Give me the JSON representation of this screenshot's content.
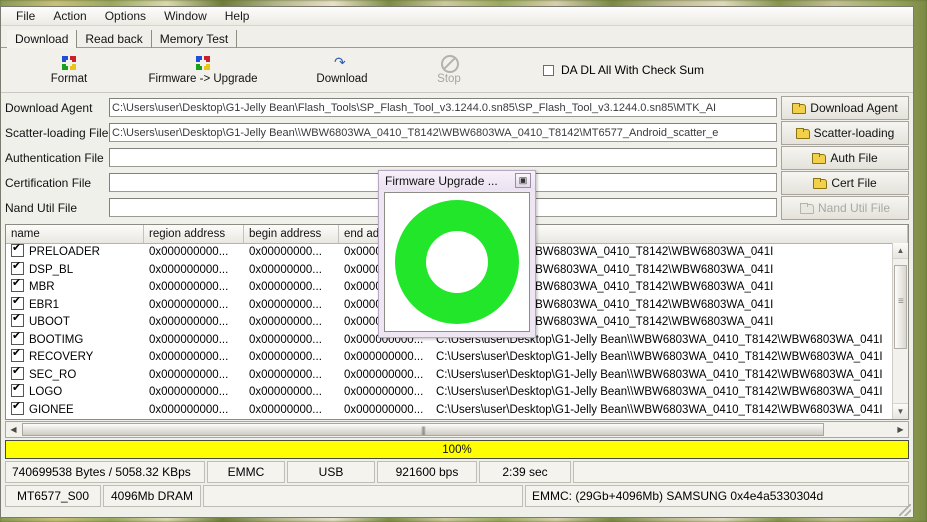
{
  "menu": {
    "items": [
      "File",
      "Action",
      "Options",
      "Window",
      "Help"
    ]
  },
  "tabs": [
    {
      "label": "Download",
      "active": true
    },
    {
      "label": "Read back",
      "active": false
    },
    {
      "label": "Memory Test",
      "active": false
    }
  ],
  "toolbar": {
    "buttons": [
      {
        "label": "Format",
        "icon": "pinwheel-icon",
        "disabled": false
      },
      {
        "label": "Firmware -> Upgrade",
        "icon": "pinwheel-icon",
        "disabled": false
      },
      {
        "label": "Download",
        "icon": "download-arrow-icon",
        "disabled": false
      },
      {
        "label": "Stop",
        "icon": "stop-icon",
        "disabled": true
      }
    ],
    "checkbox": {
      "label": "DA DL All With Check Sum",
      "checked": false
    }
  },
  "file_fields": [
    {
      "label": "Download Agent",
      "value": "C:\\Users\\user\\Desktop\\G1-Jelly Bean\\Flash_Tools\\SP_Flash_Tool_v3.1244.0.sn85\\SP_Flash_Tool_v3.1244.0.sn85\\MTK_AI",
      "button": "Download Agent",
      "disabled": false
    },
    {
      "label": "Scatter-loading File",
      "value": "C:\\Users\\user\\Desktop\\G1-Jelly Bean\\\\WBW6803WA_0410_T8142\\WBW6803WA_0410_T8142\\MT6577_Android_scatter_e",
      "button": "Scatter-loading",
      "disabled": false
    },
    {
      "label": "Authentication File",
      "value": "",
      "button": "Auth File",
      "disabled": false
    },
    {
      "label": "Certification File",
      "value": "",
      "button": "Cert File",
      "disabled": false
    },
    {
      "label": "Nand Util File",
      "value": "",
      "button": "Nand Util File",
      "disabled": true
    }
  ],
  "table": {
    "columns": [
      "name",
      "region address",
      "begin address",
      "end addi"
    ],
    "location_header": "",
    "rows": [
      {
        "checked": true,
        "name": "PRELOADER",
        "region": "0x000000000...",
        "begin": "0x00000000...",
        "end": "0x00000",
        "location": "p\\G1-Jelly Bean\\\\WBW6803WA_0410_T8142\\WBW6803WA_041I"
      },
      {
        "checked": true,
        "name": "DSP_BL",
        "region": "0x000000000...",
        "begin": "0x00000000...",
        "end": "0x00000",
        "location": "p\\G1-Jelly Bean\\\\WBW6803WA_0410_T8142\\WBW6803WA_041I"
      },
      {
        "checked": true,
        "name": "MBR",
        "region": "0x000000000...",
        "begin": "0x00000000...",
        "end": "0x00000",
        "location": "p\\G1-Jelly Bean\\\\WBW6803WA_0410_T8142\\WBW6803WA_041I"
      },
      {
        "checked": true,
        "name": "EBR1",
        "region": "0x000000000...",
        "begin": "0x00000000...",
        "end": "0x00000",
        "location": "p\\G1-Jelly Bean\\\\WBW6803WA_0410_T8142\\WBW6803WA_041I"
      },
      {
        "checked": true,
        "name": "UBOOT",
        "region": "0x000000000...",
        "begin": "0x00000000...",
        "end": "0x00000",
        "location": "p\\G1-Jelly Bean\\\\WBW6803WA_0410_T8142\\WBW6803WA_041I"
      },
      {
        "checked": true,
        "name": "BOOTIMG",
        "region": "0x000000000...",
        "begin": "0x00000000...",
        "end": "0x000000000...",
        "location": "C:\\Users\\user\\Desktop\\G1-Jelly Bean\\\\WBW6803WA_0410_T8142\\WBW6803WA_041I"
      },
      {
        "checked": true,
        "name": "RECOVERY",
        "region": "0x000000000...",
        "begin": "0x00000000...",
        "end": "0x000000000...",
        "location": "C:\\Users\\user\\Desktop\\G1-Jelly Bean\\\\WBW6803WA_0410_T8142\\WBW6803WA_041I"
      },
      {
        "checked": true,
        "name": "SEC_RO",
        "region": "0x000000000...",
        "begin": "0x00000000...",
        "end": "0x000000000...",
        "location": "C:\\Users\\user\\Desktop\\G1-Jelly Bean\\\\WBW6803WA_0410_T8142\\WBW6803WA_041I"
      },
      {
        "checked": true,
        "name": "LOGO",
        "region": "0x000000000...",
        "begin": "0x00000000...",
        "end": "0x000000000...",
        "location": "C:\\Users\\user\\Desktop\\G1-Jelly Bean\\\\WBW6803WA_0410_T8142\\WBW6803WA_041I"
      },
      {
        "checked": true,
        "name": "GIONEE",
        "region": "0x000000000...",
        "begin": "0x00000000...",
        "end": "0x000000000...",
        "location": "C:\\Users\\user\\Desktop\\G1-Jelly Bean\\\\WBW6803WA_0410_T8142\\WBW6803WA_041I"
      }
    ]
  },
  "scrollbars": {
    "v_up": "▲",
    "v_down": "▼",
    "h_left": "◀",
    "h_right": "▶"
  },
  "progress": {
    "percent_label": "100%",
    "bar_color": "#ffff00"
  },
  "status": {
    "row1": [
      "740699538 Bytes / 5058.32 KBps",
      "EMMC",
      "USB",
      "921600 bps",
      "2:39 sec",
      ""
    ],
    "row2": [
      "MT6577_S00",
      "4096Mb DRAM",
      "",
      "EMMC: (29Gb+4096Mb) SAMSUNG 0x4e4a5330304d"
    ]
  },
  "dialog": {
    "title": "Firmware Upgrade ...",
    "close_label": "▣",
    "ring_color": "#22e62a",
    "ring_hole_color": "#ffffff"
  }
}
